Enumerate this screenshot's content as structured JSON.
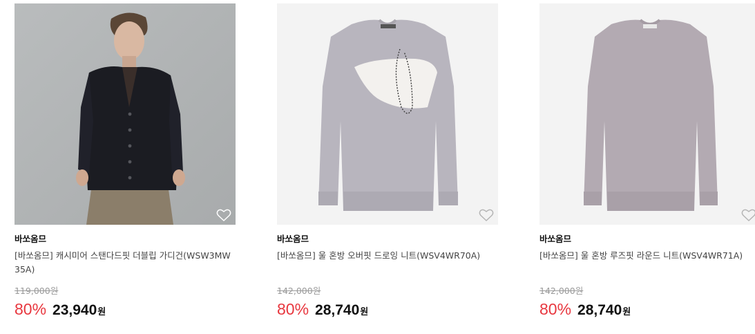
{
  "products": [
    {
      "brand": "바쏘옴므",
      "name": "[바쏘옴므] 캐시미어 스탠다드핏 더블립 가디건(WSW3MW35A)",
      "original_price": "119,000",
      "original_unit": "원",
      "discount": "80%",
      "sale_price": "23,940",
      "sale_unit": "원",
      "image": "model-wearing-black-cardigan"
    },
    {
      "brand": "바쏘옴므",
      "name": "[바쏘옴므] 울 혼방 오버핏 드로잉 니트(WSV4WR70A)",
      "original_price": "142,000",
      "original_unit": "원",
      "discount": "80%",
      "sale_price": "28,740",
      "sale_unit": "원",
      "image": "grey-sweater-white-planet-print"
    },
    {
      "brand": "바쏘옴므",
      "name": "[바쏘옴므] 울 혼방 루즈핏 라운드 니트(WSV4WR71A)",
      "original_price": "142,000",
      "original_unit": "원",
      "discount": "80%",
      "sale_price": "28,740",
      "sale_unit": "원",
      "image": "grey-round-neck-sweater"
    }
  ],
  "colors": {
    "discount": "#e8373f",
    "original_price": "#9a9a9a",
    "name": "#444444"
  },
  "icons": {
    "wishlist": "heart-outline-icon"
  }
}
